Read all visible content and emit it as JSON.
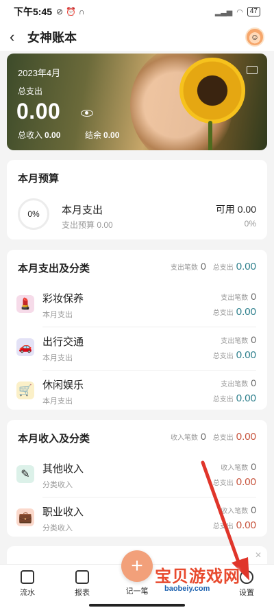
{
  "status_bar": {
    "time": "下午5:45",
    "battery": "47"
  },
  "nav": {
    "back_glyph": "‹",
    "title": "女神账本"
  },
  "hero": {
    "month": "2023年4月",
    "total_expense_label": "总支出",
    "total_expense_value": "0.00",
    "total_income_label": "总收入",
    "total_income_value": "0.00",
    "balance_label": "结余",
    "balance_value": "0.00"
  },
  "budget": {
    "title": "本月预算",
    "percent": "0%",
    "name": "本月支出",
    "sub": "支出预算 0.00",
    "available": "可用 0.00",
    "used_pct": "0%"
  },
  "expense_section": {
    "title": "本月支出及分类",
    "count_label": "支出笔数",
    "count": "0",
    "total_label": "总支出",
    "total": "0.00",
    "items": [
      {
        "name": "彩妆保养",
        "desc": "本月支出",
        "count_label": "支出笔数",
        "count": "0",
        "total_label": "总支出",
        "total": "0.00",
        "icon": "lipstick-icon"
      },
      {
        "name": "出行交通",
        "desc": "本月支出",
        "count_label": "支出笔数",
        "count": "0",
        "total_label": "总支出",
        "total": "0.00",
        "icon": "car-icon"
      },
      {
        "name": "休闲娱乐",
        "desc": "本月支出",
        "count_label": "支出笔数",
        "count": "0",
        "total_label": "总支出",
        "total": "0.00",
        "icon": "cart-icon"
      }
    ]
  },
  "income_section": {
    "title": "本月收入及分类",
    "count_label": "收入笔数",
    "count": "0",
    "total_label": "总支出",
    "total": "0.00",
    "items": [
      {
        "name": "其他收入",
        "desc": "分类收入",
        "count_label": "收入笔数",
        "count": "0",
        "total_label": "总支出",
        "total": "0.00",
        "icon": "pencil-icon"
      },
      {
        "name": "职业收入",
        "desc": "分类收入",
        "count_label": "收入笔数",
        "count": "0",
        "total_label": "总支出",
        "total": "0.00",
        "icon": "briefcase-icon"
      }
    ]
  },
  "tabbar": {
    "tab1": "流水",
    "tab2": "报表",
    "add": "记一笔",
    "tab4": "设置"
  },
  "watermark": {
    "text": "宝贝游戏网",
    "url": "baobeiy.com"
  },
  "colors": {
    "expense_total": "#2d7f8c",
    "income_total": "#c7533c",
    "fab": "#f2a07a"
  }
}
